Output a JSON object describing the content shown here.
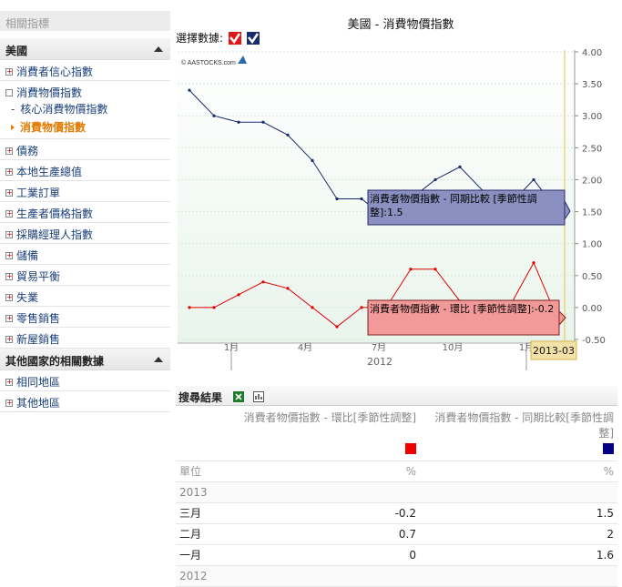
{
  "sidebar": {
    "top_label": "相關指標",
    "section_usa": "美國",
    "items": [
      {
        "label": "消費者信心指數"
      },
      {
        "label": "消費物價指數"
      }
    ],
    "sub_items": [
      "核心消費物價指數",
      "消費物價指數"
    ],
    "items2": [
      {
        "label": "債務"
      },
      {
        "label": "本地生產總值"
      },
      {
        "label": "工業訂單"
      },
      {
        "label": "生產者價格指數"
      },
      {
        "label": "採購經理人指數"
      },
      {
        "label": "儲備"
      },
      {
        "label": "貿易平衡"
      },
      {
        "label": "失業"
      },
      {
        "label": "零售銷售"
      },
      {
        "label": "新屋銷售"
      }
    ],
    "section_other": "其他國家的相關數據",
    "items3": [
      {
        "label": "相同地區"
      },
      {
        "label": "其他地區"
      }
    ]
  },
  "page_title": "美國 - 消費物價指數",
  "selector_label": "選擇數據:",
  "chart_data": {
    "type": "line",
    "watermark": "© AASTOCKS.com",
    "y_axis_right": {
      "ticks": [
        "4.00",
        "3.50",
        "3.00",
        "2.50",
        "2.00",
        "1.50",
        "1.00",
        "0.50",
        "0.00",
        "-0.50"
      ],
      "min": -0.5,
      "max": 4.0
    },
    "x_tick_labels": [
      "1月",
      "4月",
      "7月",
      "10月",
      "1月"
    ],
    "x_year_label": "2012",
    "cursor_label": "2013-03",
    "series": [
      {
        "name": "消費者物價指數 - 同期比較 [季節性調整]",
        "color": "#1a2a6e",
        "values": [
          3.4,
          3.0,
          2.9,
          2.9,
          2.7,
          2.3,
          1.7,
          1.7,
          1.4,
          1.7,
          2.0,
          2.2,
          1.8,
          1.6,
          2.0,
          1.5
        ]
      },
      {
        "name": "消費者物價指數 - 環比 [季節性調整]",
        "color": "#e00000",
        "values": [
          0.0,
          0.0,
          0.2,
          0.4,
          0.3,
          0.0,
          -0.3,
          0.0,
          0.0,
          0.6,
          0.6,
          0.1,
          -0.3,
          0.0,
          0.7,
          -0.2
        ]
      }
    ],
    "tooltips": [
      {
        "text": "消費者物價指數 - 同期比較 [季節性調整]:1.5",
        "bg": "#8a90c0"
      },
      {
        "text": "消費者物價指數 - 環比 [季節性調整]:-0.2",
        "bg": "#f29a9a"
      }
    ]
  },
  "results": {
    "title": "搜尋結果",
    "col1_header": "消費者物價指數 - 環比[季節性調整]",
    "col2_header": "消費者物價指數 - 同期比較[季節性調整]",
    "col1_color": "#ee0000",
    "col2_color": "#000080",
    "unit_label": "單位",
    "unit1": "%",
    "unit2": "%",
    "year_2013": "2013",
    "rows": [
      {
        "month": "三月",
        "v1": "-0.2",
        "v2": "1.5"
      },
      {
        "month": "二月",
        "v1": "0.7",
        "v2": "2"
      },
      {
        "month": "一月",
        "v1": "0",
        "v2": "1.6"
      }
    ],
    "year_2012": "2012"
  }
}
